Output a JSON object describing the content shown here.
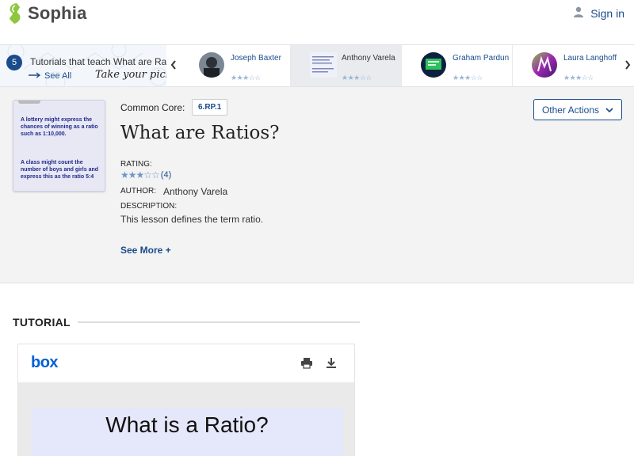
{
  "header": {
    "logo_text": "Sophia",
    "signin_label": "Sign in"
  },
  "tutorials_strip": {
    "count": "5",
    "title": "Tutorials that teach What are Ra",
    "see_all": "See All",
    "prompt": "Take your pick:",
    "cards": [
      {
        "name": "Joseph Baxter",
        "rating": 3
      },
      {
        "name": "Anthony Varela",
        "rating": 3
      },
      {
        "name": "Graham Pardun",
        "rating": 3
      },
      {
        "name": "Laura Langhoff",
        "rating": 3
      }
    ]
  },
  "lesson": {
    "common_core_label": "Common Core:",
    "standard_code": "6.RP.1",
    "title": "What are Ratios?",
    "rating_label": "RATING:",
    "rating_value": 3,
    "rating_count": "(4)",
    "author_label": "AUTHOR:",
    "author": "Anthony Varela",
    "description_label": "DESCRIPTION:",
    "description": "This lesson defines the term ratio.",
    "see_more": "See More +",
    "other_actions": "Other Actions",
    "thumbnail_text": [
      "A lottery might express the chances of winning as a ratio such as 1:10,000.",
      "A class might count the number of boys and girls and express this as the ratio 5:4"
    ]
  },
  "tutorial": {
    "heading": "TUTORIAL",
    "viewer_brand": "box",
    "slide_title": "What is a Ratio?"
  },
  "colors": {
    "brand_green": "#8dc63f",
    "link_blue": "#1a4c8b",
    "box_blue": "#0061d5"
  }
}
